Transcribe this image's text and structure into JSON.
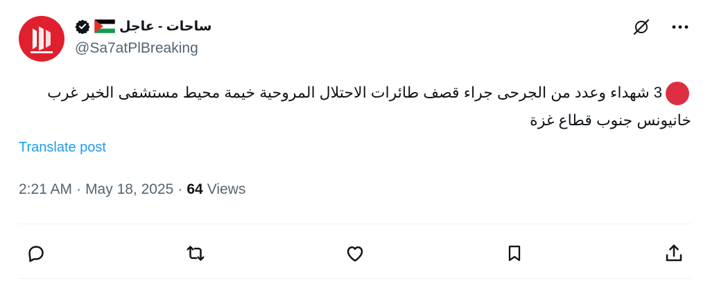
{
  "account": {
    "name": "ساحات - عاجل",
    "handle": "@Sa7atPlBreaking",
    "avatar_color": "#e0202e",
    "verified": true,
    "flag": "palestine-flag"
  },
  "post": {
    "marker_color": "#dd2e44",
    "text_line1": "3 شهداء وعدد من الجرحى جراء قصف طائرات الاحتلال المروحية خيمة محيط مستشفى الخير غرب",
    "text_line2": "خانيونس جنوب قطاع غزة",
    "translate_label": "Translate post",
    "time": "2:21 AM",
    "date": "May 18, 2025",
    "views_count": "64",
    "views_label": "Views"
  },
  "actions": [
    "reply-icon",
    "repost-icon",
    "like-icon",
    "bookmark-icon",
    "share-icon"
  ],
  "colors": {
    "link": "#1d9bf0",
    "muted": "#536471",
    "text": "#0f1419"
  }
}
